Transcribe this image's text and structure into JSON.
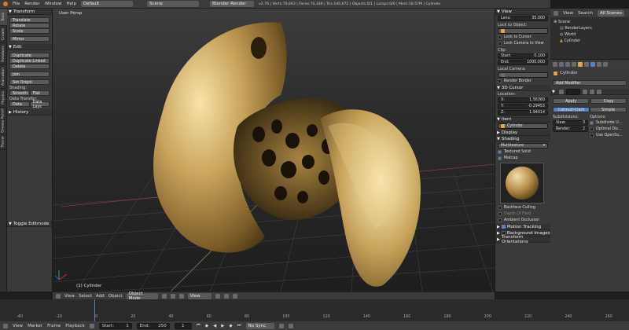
{
  "topbar": {
    "menus": [
      "File",
      "Render",
      "Window",
      "Help"
    ],
    "screen_layout": "Default",
    "scene": "Scene",
    "engine": "Blender Render",
    "stats": "v2.76 | Verts:70,663 | Faces:70,336 | Tris:140,672 | Objects:0/1 | Lamps:0/0 | Mem:18.57M | Cylinder"
  },
  "toolshelf": {
    "tabs": [
      "Tools",
      "Create",
      "Relations",
      "Animation",
      "Physics",
      "Grease Pencil",
      "Tissue"
    ],
    "transform_header": "Transform",
    "transform_buttons": [
      "Translate",
      "Rotate",
      "Scale"
    ],
    "mirror": "Mirror",
    "edit_header": "Edit",
    "edit_buttons": [
      "Duplicate",
      "Duplicate Linked",
      "Delete"
    ],
    "join": "Join",
    "set_origin": "Set Origin",
    "shading_label": "Shading:",
    "smooth": "Smooth",
    "flat": "Flat",
    "data_transfer_label": "Data Transfer:",
    "data": "Data",
    "data_lays": "Data Lays",
    "history_header": "History",
    "toggle_editmode": "Toggle Editmode"
  },
  "viewport": {
    "view_label": "User Persp",
    "object_label": "(1) Cylinder",
    "header": {
      "menus": [
        "View",
        "Select",
        "Add",
        "Object"
      ],
      "mode": "Object Mode",
      "orientation": "View"
    }
  },
  "npanel": {
    "view_header": "View",
    "lens_label": "Lens:",
    "lens_value": "35.000",
    "lock_to_object": "Lock to Object:",
    "lock_to_cursor": "Lock to Cursor",
    "lock_camera": "Lock Camera to View",
    "clip_label": "Clip:",
    "clip_start_label": "Start:",
    "clip_start_value": "0.100",
    "clip_end_label": "End:",
    "clip_end_value": "1000.000",
    "local_camera": "Local Camera:",
    "render_border": "Render Border",
    "cursor_header": "3D Cursor",
    "location_label": "Location:",
    "x_label": "X:",
    "x_value": "1.56360",
    "y_label": "Y:",
    "y_value": "-0.29453",
    "z_label": "Z:",
    "z_value": "1.94014",
    "item_header": "Item",
    "item_name": "Cylinder",
    "display_header": "Display",
    "shading_header": "Shading",
    "shading_mode": "Multitexture",
    "textured_solid": "Textured Solid",
    "matcap": "Matcap",
    "backface_culling": "Backface Culling",
    "depth_of_field": "Depth Of Field",
    "ambient_occlusion": "Ambient Occlusion",
    "motion_tracking": "Motion Tracking",
    "background_images": "Background Images",
    "transform_orientations": "Transform Orientations"
  },
  "outliner": {
    "menus": [
      "View",
      "Search"
    ],
    "filter": "All Scenes",
    "items": [
      "Scene",
      "RenderLayers",
      "World",
      "Cylinder"
    ]
  },
  "properties": {
    "object_name": "Cylinder",
    "add_modifier": "Add Modifier",
    "apply": "Apply",
    "copy": "Copy",
    "catmull": "Catmull-Clark",
    "simple": "Simple",
    "subdivisions": "Subdivisions:",
    "options": "Options:",
    "view_label": "View:",
    "view_value": "3",
    "render_label": "Render:",
    "render_value": "2",
    "subdivide_uvs": "Subdivide U...",
    "optimal_display": "Optimal Dis...",
    "use_opensubdiv": "Use OpenSu..."
  },
  "timeline": {
    "menus": [
      "View",
      "Marker",
      "Frame",
      "Playback"
    ],
    "start_label": "Start:",
    "start_value": "1",
    "end_label": "End:",
    "end_value": "250",
    "current_frame": "1",
    "sync": "No Sync",
    "ticks": [
      "-40",
      "-20",
      "0",
      "20",
      "40",
      "60",
      "80",
      "100",
      "120",
      "140",
      "160",
      "180",
      "200",
      "220",
      "240",
      "260"
    ]
  }
}
